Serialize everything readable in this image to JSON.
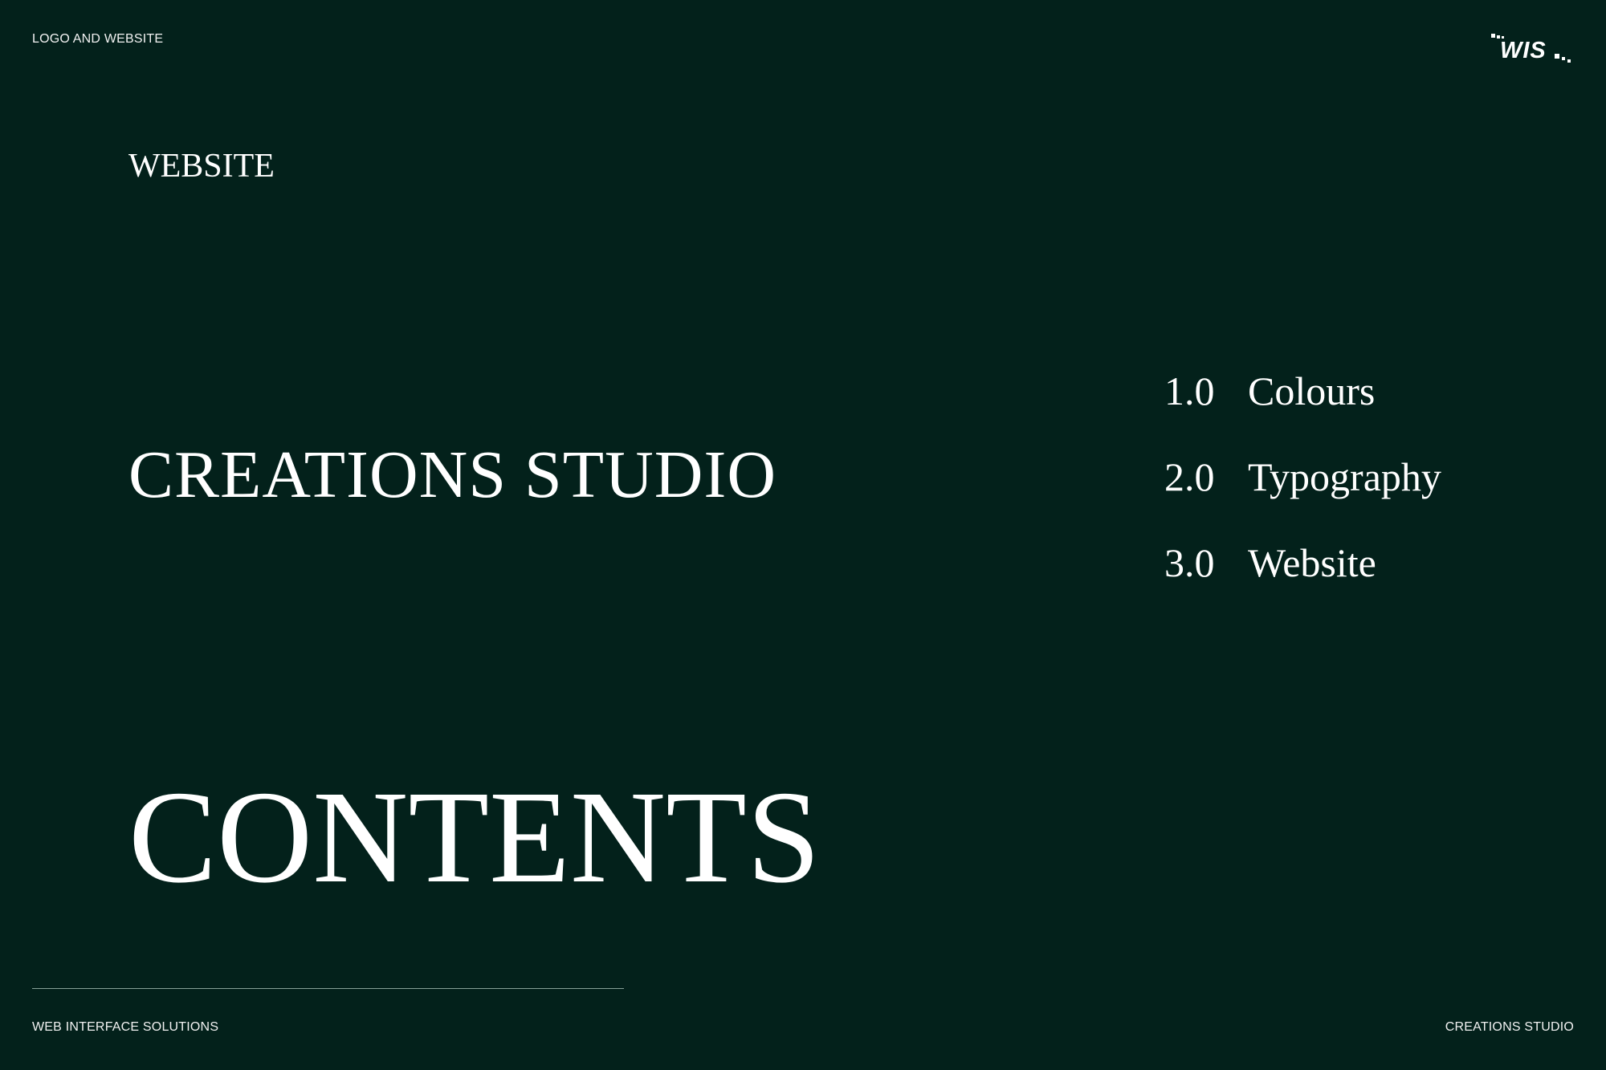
{
  "header": {
    "label": "LOGO AND WEBSITE"
  },
  "logo": {
    "text": "WIS",
    "icon": "wis-logo-icon"
  },
  "section": {
    "label": "WEBSITE"
  },
  "studio": {
    "title": "CREATIONS STUDIO"
  },
  "contents": {
    "title": "CONTENTS"
  },
  "toc": {
    "items": [
      {
        "number": "1.0",
        "label": "Colours"
      },
      {
        "number": "2.0",
        "label": "Typography"
      },
      {
        "number": "3.0",
        "label": "Website"
      }
    ]
  },
  "footer": {
    "left": "WEB INTERFACE SOLUTIONS",
    "right": "CREATIONS STUDIO"
  },
  "colors": {
    "background": "#03211b",
    "text": "#ffffff",
    "divider": "#86a097"
  }
}
